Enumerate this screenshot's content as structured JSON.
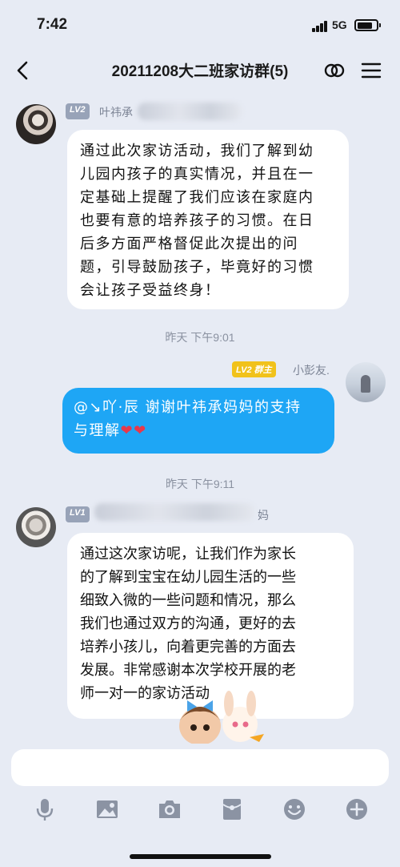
{
  "status": {
    "time": "7:42",
    "network": "5G"
  },
  "header": {
    "title": "20211208大二班家访群(5)"
  },
  "messages": [
    {
      "level": "LV2",
      "name": "叶祎承",
      "text_lines": [
        "通过此次家访活动，我们了解到幼",
        "儿园内孩子的真实情况，并且在一",
        "定基础上提醒了我们应该在家庭内",
        "也要有意的培养孩子的习惯。在日",
        "后多方面严格督促此次提出的问",
        "题，引导鼓励孩子，毕竟好的习惯",
        "会让孩子受益终身！"
      ]
    },
    {
      "timestamp": "昨天 下午9:01"
    },
    {
      "level": "LV2",
      "role": "群主",
      "name": "小彭友.",
      "text_lines": [
        "@↘吖·辰  谢谢叶祎承妈妈的支持",
        "与理解"
      ],
      "hearts": "❤❤"
    },
    {
      "timestamp": "昨天 下午9:11"
    },
    {
      "level": "LV1",
      "name": "妈",
      "text_lines": [
        "通过这次家访呢，让我们作为家长",
        "的了解到宝宝在幼儿园生活的一些",
        "细致入微的一些问题和情况，那么",
        "我们也通过双方的沟通，更好的去",
        "培养小孩儿，向着更完善的方面去",
        "发展。非常感谢本次学校开展的老",
        "师一对一的家访活动"
      ]
    }
  ],
  "input": {
    "placeholder": ""
  },
  "colors": {
    "outgoing_bubble": "#1ea6f5",
    "lv2_badge": "#98a3b8",
    "owner_badge": "#f1c21b",
    "background": "#e7ebf4"
  },
  "toolbar_icons": [
    "mic-icon",
    "image-icon",
    "camera-icon",
    "red-packet-icon",
    "emoji-icon",
    "plus-icon"
  ]
}
